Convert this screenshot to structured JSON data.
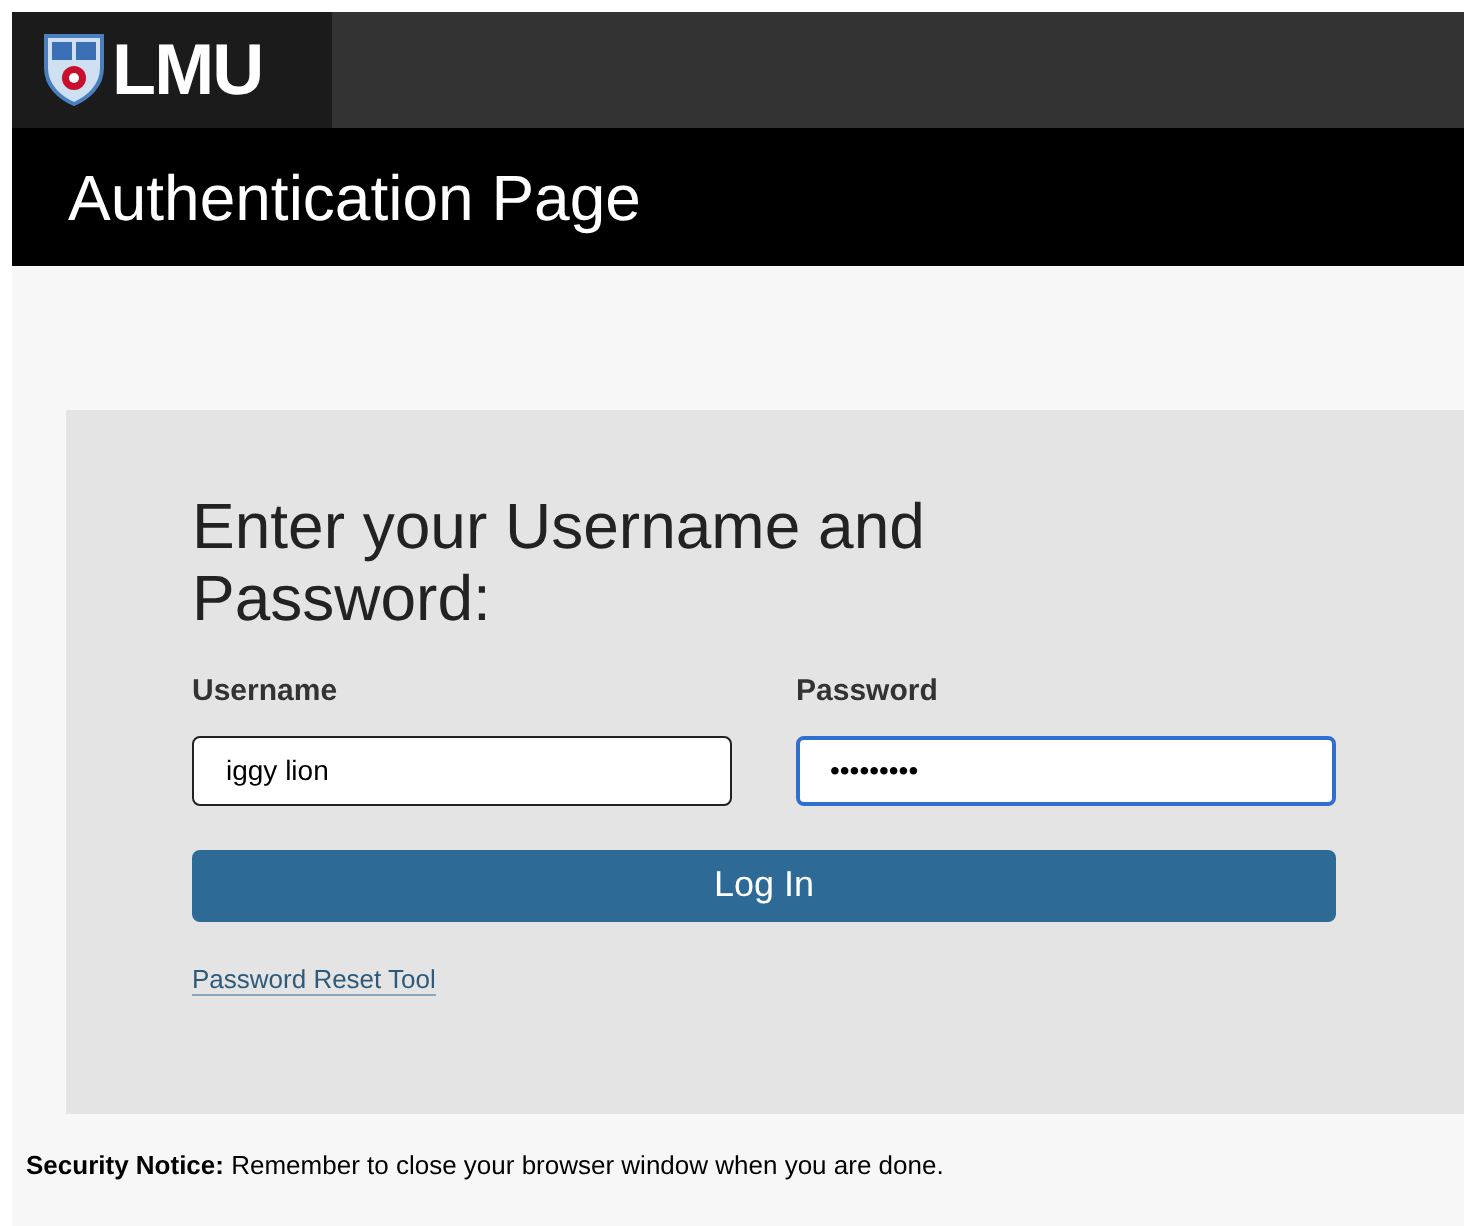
{
  "header": {
    "logo_text": "LMU",
    "title": "Authentication Page"
  },
  "form": {
    "heading": "Enter your Username and Password:",
    "fields": [
      {
        "label": "Username",
        "value": "iggy lion",
        "focused": false
      },
      {
        "label": "Password",
        "value": "•••••••••",
        "focused": true
      }
    ],
    "button": "Log In",
    "link": "Password Reset Tool"
  },
  "notice": "**Security Notice:** Remember to close your browser window when you are done."
}
